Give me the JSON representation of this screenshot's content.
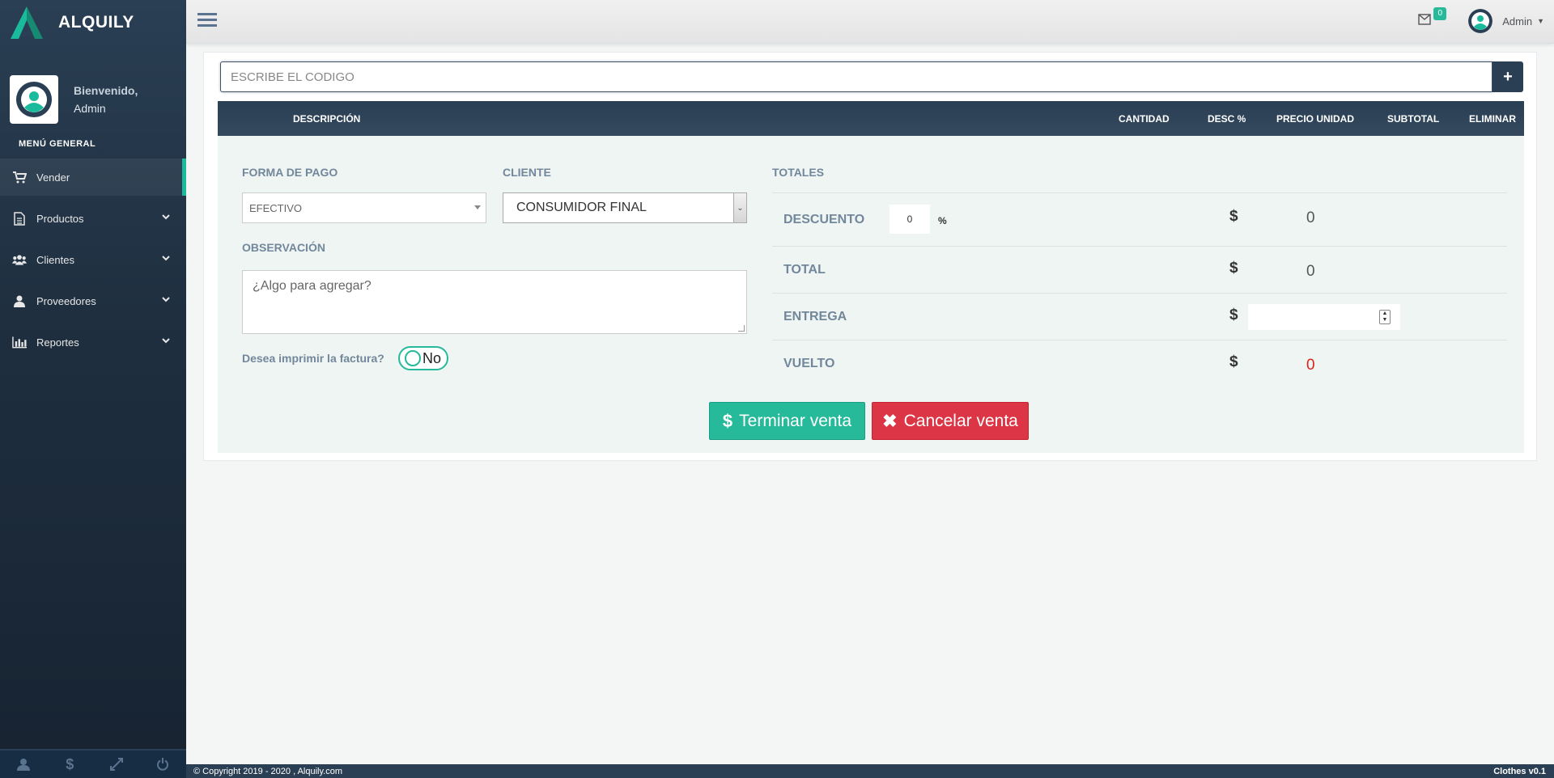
{
  "brand": {
    "name": "ALQUILY"
  },
  "profile": {
    "welcome": "Bienvenido,",
    "name": "Admin"
  },
  "sidebar": {
    "section_title": "MENÚ GENERAL",
    "items": [
      {
        "label": "Vender",
        "icon": "cart-icon",
        "active": true
      },
      {
        "label": "Productos",
        "icon": "document-icon"
      },
      {
        "label": "Clientes",
        "icon": "users-icon"
      },
      {
        "label": "Proveedores",
        "icon": "user-icon"
      },
      {
        "label": "Reportes",
        "icon": "bar-chart-icon"
      }
    ],
    "footer_icons": [
      "user-icon",
      "dollar-icon",
      "expand-icon",
      "power-icon"
    ]
  },
  "topnav": {
    "mail_count": "0",
    "user": "Admin"
  },
  "code_search": {
    "placeholder": "ESCRIBE EL CODIGO",
    "add_icon": "plus-icon"
  },
  "table": {
    "headers": {
      "descripcion": "DESCRIPCIÓN",
      "cantidad": "CANTIDAD",
      "desc": "DESC %",
      "precio": "PRECIO UNIDAD",
      "subtotal": "SUBTOTAL",
      "eliminar": "ELIMINAR"
    }
  },
  "form": {
    "pago_label": "FORMA DE PAGO",
    "pago_value": "EFECTIVO",
    "cliente_label": "CLIENTE",
    "cliente_value": "CONSUMIDOR FINAL",
    "obs_label": "OBSERVACIÓN",
    "obs_placeholder": "¿Algo para agregar?",
    "print_label": "Desea imprimir la factura?",
    "print_value": "No"
  },
  "totals": {
    "title": "TOTALES",
    "descuento_label": "DESCUENTO",
    "descuento_value": "0",
    "percent": "%",
    "descuento_amount": "0",
    "total_label": "TOTAL",
    "total_amount": "0",
    "entrega_label": "ENTREGA",
    "vuelto_label": "VUELTO",
    "vuelto_amount": "0",
    "currency": "$"
  },
  "actions": {
    "finish": "Terminar venta",
    "cancel": "Cancelar venta"
  },
  "footer": {
    "copyright": "© Copyright 2019 - 2020 , Alquily.com",
    "version": "Clothes v0.1"
  },
  "colors": {
    "accent": "#26b99a",
    "danger": "#dc3545",
    "sidebar": "#2a3f54",
    "vuelto": "#d9261c"
  }
}
